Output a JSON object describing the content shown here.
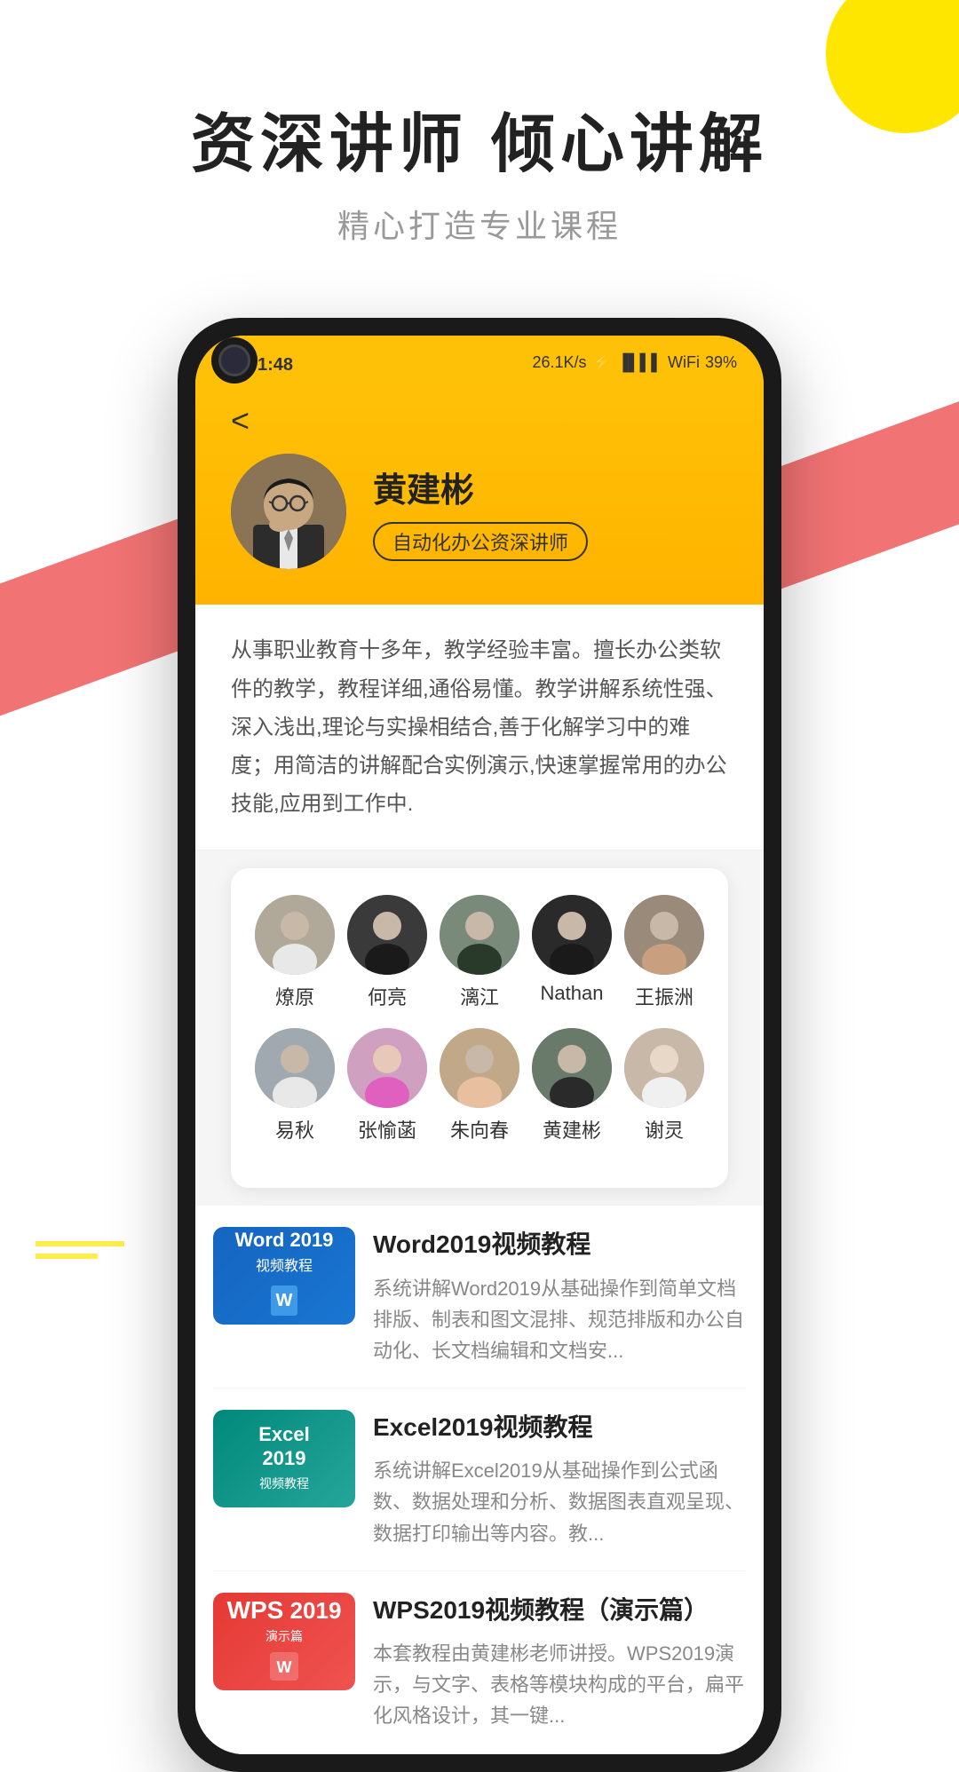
{
  "page": {
    "title": "资深讲师 倾心讲解",
    "subtitle": "精心打造专业课程"
  },
  "statusBar": {
    "time": "下午1:48",
    "network": "26.1K/s",
    "battery": "39%"
  },
  "teacher": {
    "name": "黄建彬",
    "badge": "自动化办公资深讲师",
    "description": "从事职业教育十多年，教学经验丰富。擅长办公类软件的教学，教程详细,通俗易懂。教学讲解系统性强、深入浅出,理论与实操相结合,善于化解学习中的难度；用简洁的讲解配合实例演示,快速掌握常用的办公技能,应用到工作中.",
    "backBtn": "<"
  },
  "instructors": {
    "row1": [
      {
        "name": "燎原",
        "avClass": "av-1"
      },
      {
        "name": "何亮",
        "avClass": "av-2"
      },
      {
        "name": "漓江",
        "avClass": "av-3"
      },
      {
        "name": "Nathan",
        "avClass": "av-4"
      },
      {
        "name": "王振洲",
        "avClass": "av-5"
      }
    ],
    "row2": [
      {
        "name": "易秋",
        "avClass": "av-6"
      },
      {
        "name": "张愉菡",
        "avClass": "av-7"
      },
      {
        "name": "朱向春",
        "avClass": "av-8"
      },
      {
        "name": "黄建彬",
        "avClass": "av-9"
      },
      {
        "name": "谢灵",
        "avClass": "av-10"
      }
    ]
  },
  "courses": [
    {
      "title": "Word2019视频教程",
      "description": "系统讲解Word2019从基础操作到简单文档排版、制表和图文混排、规范排版和办公自动化、长文档编辑和文档安...",
      "thumbType": "word",
      "thumbLabel": "Word 2019",
      "thumbSub": "视频教程"
    },
    {
      "title": "Excel2019视频教程",
      "description": "系统讲解Excel2019从基础操作到公式函数、数据处理和分析、数据图表直观呈现、数据打印输出等内容。教...",
      "thumbType": "excel",
      "thumbLabel": "Excel\n2019",
      "thumbSub": "视频教程"
    },
    {
      "title": "WPS2019视频教程（演示篇）",
      "description": "本套教程由黄建彬老师讲授。WPS2019演示，与文字、表格等模块构成的平台，扁平化风格设计，其一键...",
      "thumbType": "wps",
      "thumbLabel": "WPS 2019",
      "thumbSub": "演示篇"
    }
  ]
}
